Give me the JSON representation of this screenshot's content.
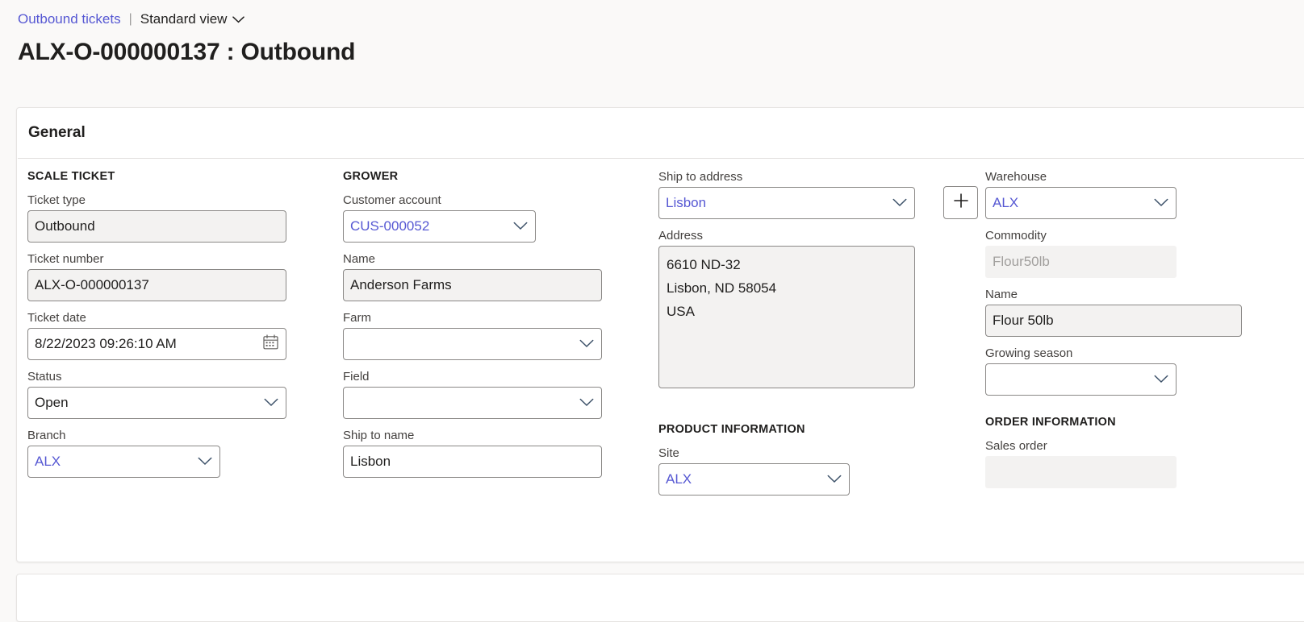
{
  "breadcrumb": {
    "link": "Outbound tickets",
    "separator": "|",
    "view": "Standard view",
    "chevron_icon": "chevron-down-icon"
  },
  "page_title": "ALX-O-000000137 : Outbound",
  "card": {
    "header": "General"
  },
  "colors": {
    "link_blue": "#5658d3",
    "value_blue": "#5658d3",
    "page_background": "#faf9f8",
    "card_background": "#ffffff",
    "readonly_fill": "#f3f2f1",
    "border": "#8a8886",
    "label_text": "#44413f"
  },
  "columns": {
    "scale_ticket": {
      "section": "SCALE TICKET",
      "fields": [
        {
          "label": "Ticket type",
          "value": "Outbound",
          "placeholder": "",
          "type": "text",
          "style": "readonly"
        },
        {
          "label": "Ticket number",
          "value": "ALX-O-000000137",
          "placeholder": "",
          "type": "text",
          "style": "readonly"
        },
        {
          "label": "Ticket date",
          "value": "8/22/2023 09:26:10 AM",
          "placeholder": "",
          "type": "date",
          "style": "normal",
          "icon": "calendar-icon"
        },
        {
          "label": "Status",
          "value": "Open",
          "placeholder": "",
          "type": "combobox",
          "style": "normal",
          "icon": "chevron-down-icon"
        },
        {
          "label": "Branch",
          "value": "ALX",
          "placeholder": "",
          "type": "combobox",
          "style": "normal",
          "value_color": "blue",
          "icon": "chevron-down-icon"
        }
      ]
    },
    "grower": {
      "section": "GROWER",
      "fields": [
        {
          "label": "Customer account",
          "value": "CUS-000052",
          "placeholder": "",
          "type": "combobox",
          "style": "normal",
          "value_color": "blue",
          "icon": "chevron-down-icon"
        },
        {
          "label": "Name",
          "value": "Anderson Farms",
          "placeholder": "",
          "type": "text",
          "style": "readonly"
        },
        {
          "label": "Farm",
          "value": "",
          "placeholder": "",
          "type": "combobox",
          "style": "normal",
          "icon": "chevron-down-icon"
        },
        {
          "label": "Field",
          "value": "",
          "placeholder": "",
          "type": "combobox",
          "style": "normal",
          "icon": "chevron-down-icon"
        },
        {
          "label": "Ship to name",
          "value": "Lisbon",
          "placeholder": "",
          "type": "text",
          "style": "normal"
        }
      ]
    },
    "shipping": {
      "ship_to_address": {
        "label": "Ship to address",
        "value": "Lisbon",
        "icon": "chevron-down-icon"
      },
      "add_button": {
        "icon": "plus-icon",
        "label": "+"
      },
      "address": {
        "label": "Address",
        "value": "6610 ND-32\nLisbon, ND 58054\nUSA"
      },
      "product_information": {
        "section": "PRODUCT INFORMATION",
        "site": {
          "label": "Site",
          "value": "ALX",
          "icon": "chevron-down-icon"
        }
      }
    },
    "warehouse_col": {
      "fields": [
        {
          "label": "Warehouse",
          "value": "ALX",
          "placeholder": "",
          "type": "combobox",
          "style": "normal",
          "value_color": "blue",
          "icon": "chevron-down-icon"
        },
        {
          "label": "Commodity",
          "value": "Flour50lb",
          "placeholder": "",
          "type": "text",
          "style": "flat"
        },
        {
          "label": "Name",
          "value": "Flour 50lb",
          "placeholder": "",
          "type": "text",
          "style": "readonly"
        },
        {
          "label": "Growing season",
          "value": "",
          "placeholder": "",
          "type": "combobox",
          "style": "normal",
          "icon": "chevron-down-icon"
        }
      ],
      "order_information": {
        "section": "ORDER INFORMATION",
        "sales_order": {
          "label": "Sales order",
          "value": ""
        }
      }
    }
  }
}
